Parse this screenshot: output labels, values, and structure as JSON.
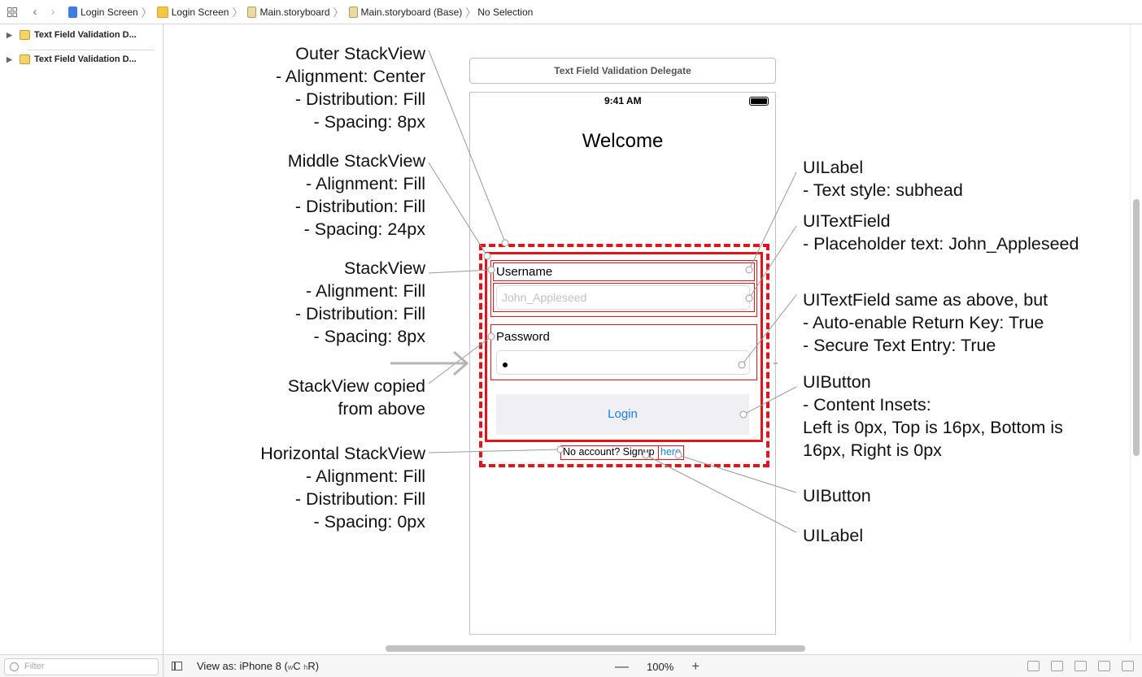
{
  "jumpbar": {
    "crumbs": [
      "Login Screen",
      "Login Screen",
      "Main.storyboard",
      "Main.storyboard (Base)",
      "No Selection"
    ]
  },
  "navigator": {
    "items": [
      "Text Field Validation D...",
      "Text Field Validation D..."
    ],
    "filter_placeholder": "Filter"
  },
  "bottombar": {
    "view_as": "View as: iPhone 8 (",
    "size_w": "w",
    "size_c": "C",
    "size_h": "h",
    "size_r": "R)",
    "zoom_minus": "—",
    "zoom": "100%",
    "zoom_plus": "+"
  },
  "scene": {
    "title": "Text Field Validation Delegate",
    "status_time": "9:41 AM",
    "welcome": "Welcome",
    "username_label": "Username",
    "username_placeholder": "John_Appleseed",
    "password_label": "Password",
    "login_button": "Login",
    "no_account": "No account? Signup",
    "here_button": "here"
  },
  "annotations_left": [
    [
      "Outer StackView",
      "- Alignment: Center",
      "- Distribution: Fill",
      "- Spacing: 8px"
    ],
    [
      "Middle StackView",
      "- Alignment: Fill",
      "- Distribution: Fill",
      "- Spacing: 24px"
    ],
    [
      "StackView",
      "- Alignment: Fill",
      "- Distribution: Fill",
      "- Spacing: 8px"
    ],
    [
      "StackView copied",
      "from above"
    ],
    [
      "Horizontal StackView",
      "- Alignment: Fill",
      "- Distribution: Fill",
      "- Spacing: 0px"
    ]
  ],
  "annotations_right": [
    [
      "UILabel",
      "- Text style: subhead"
    ],
    [
      "UITextField",
      "- Placeholder text: John_Appleseed"
    ],
    [
      "UITextField same as above, but",
      "- Auto-enable Return Key: True",
      "- Secure Text Entry: True"
    ],
    [
      "UIButton",
      "- Content Insets:",
      "Left is 0px, Top is 16px, Bottom is",
      "16px, Right is 0px"
    ],
    [
      "UIButton"
    ],
    [
      "UILabel"
    ]
  ],
  "colors": {
    "highlight": "#e0141a",
    "link": "#1a7ee6",
    "button_bg": "#efeff4"
  }
}
